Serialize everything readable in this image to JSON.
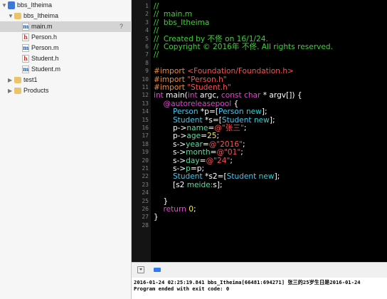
{
  "navigator": {
    "items": [
      {
        "label": "bbs_Itheima",
        "icon": "project-icon"
      },
      {
        "label": "bbs_Itheima",
        "icon": "folder-icon"
      },
      {
        "label": "main.m",
        "icon": "m-file-icon",
        "flag": "?",
        "selected": true
      },
      {
        "label": "Person.h",
        "icon": "h-file-icon"
      },
      {
        "label": "Person.m",
        "icon": "m-file-icon"
      },
      {
        "label": "Student.h",
        "icon": "h-file-icon"
      },
      {
        "label": "Student.m",
        "icon": "m-file-icon"
      },
      {
        "label": "test1",
        "icon": "folder-icon"
      },
      {
        "label": "Products",
        "icon": "folder-icon"
      }
    ]
  },
  "editor": {
    "line_numbers": [
      "1",
      "2",
      "3",
      "4",
      "5",
      "6",
      "7",
      "8",
      "9",
      "10",
      "11",
      "12",
      "13",
      "14",
      "15",
      "16",
      "17",
      "18",
      "19",
      "20",
      "21",
      "22",
      "23",
      "24",
      "25",
      "26",
      "27",
      "28"
    ],
    "lines": [
      {
        "tokens": [
          {
            "t": "//",
            "c": "comment"
          }
        ]
      },
      {
        "tokens": [
          {
            "t": "//  main.m",
            "c": "comment"
          }
        ]
      },
      {
        "tokens": [
          {
            "t": "//  bbs_Itheima",
            "c": "comment"
          }
        ]
      },
      {
        "tokens": [
          {
            "t": "//",
            "c": "comment"
          }
        ]
      },
      {
        "tokens": [
          {
            "t": "//  Created by 不佟 on 16/1/24.",
            "c": "comment"
          }
        ]
      },
      {
        "tokens": [
          {
            "t": "//  Copyright © 2016年 不佟. All rights reserved.",
            "c": "comment"
          }
        ]
      },
      {
        "tokens": [
          {
            "t": "//",
            "c": "comment"
          }
        ]
      },
      {
        "tokens": []
      },
      {
        "tokens": [
          {
            "t": "#import ",
            "c": "pp"
          },
          {
            "t": "<Foundation/Foundation.h>",
            "c": "str"
          }
        ]
      },
      {
        "tokens": [
          {
            "t": "#import ",
            "c": "pp"
          },
          {
            "t": "\"Person.h\"",
            "c": "str"
          }
        ]
      },
      {
        "tokens": [
          {
            "t": "#import ",
            "c": "pp"
          },
          {
            "t": "\"Student.h\"",
            "c": "str"
          }
        ]
      },
      {
        "tokens": [
          {
            "t": "int",
            "c": "kw"
          },
          {
            "t": " main(",
            "c": "plain"
          },
          {
            "t": "int",
            "c": "kw"
          },
          {
            "t": " argc, ",
            "c": "plain"
          },
          {
            "t": "const",
            "c": "kw"
          },
          {
            "t": " ",
            "c": "plain"
          },
          {
            "t": "char",
            "c": "kw"
          },
          {
            "t": " * argv[]) {",
            "c": "plain"
          }
        ]
      },
      {
        "tokens": [
          {
            "t": "    ",
            "c": "plain"
          },
          {
            "t": "@autoreleasepool",
            "c": "kw"
          },
          {
            "t": " {",
            "c": "plain"
          }
        ]
      },
      {
        "tokens": [
          {
            "t": "        ",
            "c": "plain"
          },
          {
            "t": "Person",
            "c": "type"
          },
          {
            "t": " *p=[",
            "c": "plain"
          },
          {
            "t": "Person",
            "c": "type"
          },
          {
            "t": " ",
            "c": "plain"
          },
          {
            "t": "new",
            "c": "method"
          },
          {
            "t": "];",
            "c": "plain"
          }
        ]
      },
      {
        "tokens": [
          {
            "t": "        ",
            "c": "plain"
          },
          {
            "t": "Student",
            "c": "type"
          },
          {
            "t": " *s=[",
            "c": "plain"
          },
          {
            "t": "Student",
            "c": "type"
          },
          {
            "t": " ",
            "c": "plain"
          },
          {
            "t": "new",
            "c": "method"
          },
          {
            "t": "];",
            "c": "plain"
          }
        ]
      },
      {
        "tokens": [
          {
            "t": "        p->",
            "c": "plain"
          },
          {
            "t": "name",
            "c": "id"
          },
          {
            "t": "=",
            "c": "plain"
          },
          {
            "t": "@\"张三\"",
            "c": "str"
          },
          {
            "t": ";",
            "c": "plain"
          }
        ]
      },
      {
        "tokens": [
          {
            "t": "        p->",
            "c": "plain"
          },
          {
            "t": "age",
            "c": "id"
          },
          {
            "t": "=",
            "c": "plain"
          },
          {
            "t": "25",
            "c": "num"
          },
          {
            "t": ";",
            "c": "plain"
          }
        ]
      },
      {
        "tokens": [
          {
            "t": "        s->",
            "c": "plain"
          },
          {
            "t": "year",
            "c": "id"
          },
          {
            "t": "=",
            "c": "plain"
          },
          {
            "t": "@\"2016\"",
            "c": "str"
          },
          {
            "t": ";",
            "c": "plain"
          }
        ]
      },
      {
        "tokens": [
          {
            "t": "        s->",
            "c": "plain"
          },
          {
            "t": "month",
            "c": "id"
          },
          {
            "t": "=",
            "c": "plain"
          },
          {
            "t": "@\"01\"",
            "c": "str"
          },
          {
            "t": ";",
            "c": "plain"
          }
        ]
      },
      {
        "tokens": [
          {
            "t": "        s->",
            "c": "plain"
          },
          {
            "t": "day",
            "c": "id"
          },
          {
            "t": "=",
            "c": "plain"
          },
          {
            "t": "@\"24\"",
            "c": "str"
          },
          {
            "t": ";",
            "c": "plain"
          }
        ]
      },
      {
        "tokens": [
          {
            "t": "        s->",
            "c": "plain"
          },
          {
            "t": "p",
            "c": "id"
          },
          {
            "t": "=p;",
            "c": "plain"
          }
        ]
      },
      {
        "tokens": [
          {
            "t": "        ",
            "c": "plain"
          },
          {
            "t": "Student",
            "c": "type"
          },
          {
            "t": " *s2=[",
            "c": "plain"
          },
          {
            "t": "Student",
            "c": "type"
          },
          {
            "t": " ",
            "c": "plain"
          },
          {
            "t": "new",
            "c": "method"
          },
          {
            "t": "];",
            "c": "plain"
          }
        ]
      },
      {
        "tokens": [
          {
            "t": "        [s2 ",
            "c": "plain"
          },
          {
            "t": "meide:",
            "c": "id"
          },
          {
            "t": "s];",
            "c": "plain"
          }
        ]
      },
      {
        "tokens": []
      },
      {
        "tokens": [
          {
            "t": "    }",
            "c": "plain"
          }
        ]
      },
      {
        "tokens": [
          {
            "t": "    ",
            "c": "plain"
          },
          {
            "t": "return",
            "c": "kw"
          },
          {
            "t": " ",
            "c": "plain"
          },
          {
            "t": "0",
            "c": "num"
          },
          {
            "t": ";",
            "c": "plain"
          }
        ]
      },
      {
        "tokens": [
          {
            "t": "}",
            "c": "plain"
          }
        ]
      },
      {
        "tokens": []
      }
    ]
  },
  "console": {
    "lines": [
      "2016-01-24 02:25:19.841 bbs_Itheima[66481:694271] 张三的25岁生日是2016-01-24",
      "Program ended with exit code: 0"
    ]
  },
  "colors": {
    "comment": "#41d039",
    "preprocessor": "#f08a3c",
    "string": "#f45257",
    "keyword": "#d94bc9",
    "class": "#4ec5e8",
    "ivar": "#61d6a0",
    "number": "#f2e85a",
    "editor_bg": "#000000"
  }
}
